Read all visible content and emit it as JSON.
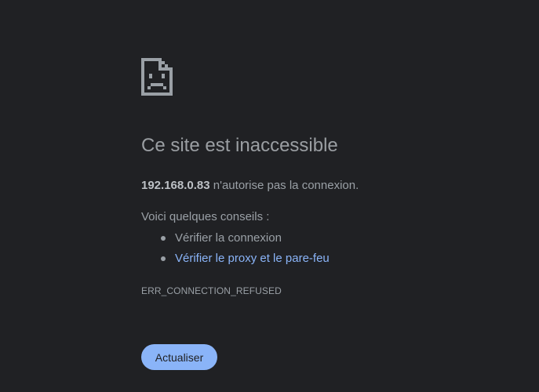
{
  "error_page": {
    "icon": "sad-file-icon",
    "title": "Ce site est inaccessible",
    "host": "192.168.0.83",
    "host_message": " n'autorise pas la connexion.",
    "suggestions_heading": "Voici quelques conseils :",
    "suggestions": [
      {
        "label": "Vérifier la connexion",
        "is_link": false
      },
      {
        "label": "Vérifier le proxy et le pare-feu",
        "is_link": true
      }
    ],
    "error_code": "ERR_CONNECTION_REFUSED",
    "reload_label": "Actualiser"
  },
  "colors": {
    "background": "#202124",
    "text": "#9aa0a6",
    "link": "#8ab4f8",
    "button": "#8ab4f8"
  }
}
